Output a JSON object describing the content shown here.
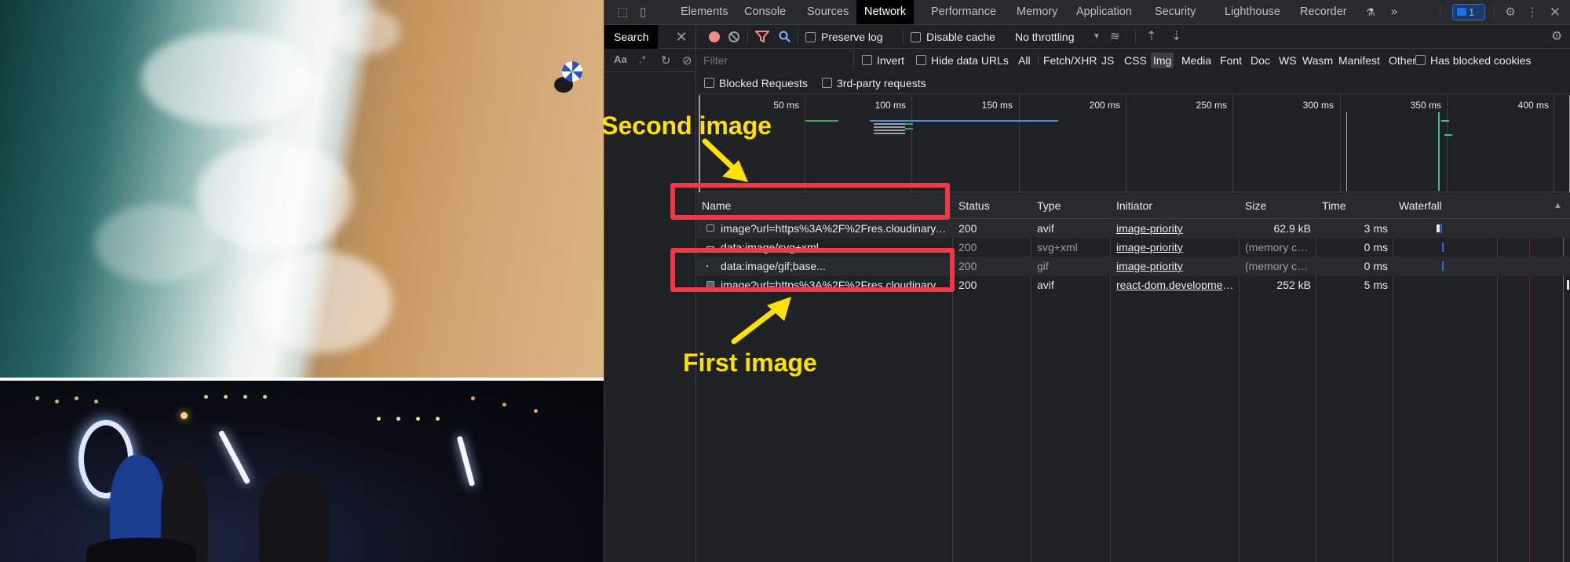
{
  "devtools": {
    "main_tabs": [
      "Elements",
      "Console",
      "Sources",
      "Network",
      "Performance",
      "Memory",
      "Application",
      "Security",
      "Lighthouse",
      "Recorder"
    ],
    "active_tab": "Network",
    "more_tabs": "»",
    "issues_count": "1"
  },
  "search_panel": {
    "title": "Search",
    "match_case": "Aa",
    "regex": ".*"
  },
  "network_toolbar": {
    "preserve_log": "Preserve log",
    "disable_cache": "Disable cache",
    "throttling": "No throttling"
  },
  "filter_bar": {
    "placeholder": "Filter",
    "invert": "Invert",
    "hide_data_urls": "Hide data URLs",
    "type_filters": [
      "All",
      "Fetch/XHR",
      "JS",
      "CSS",
      "Img",
      "Media",
      "Font",
      "Doc",
      "WS",
      "Wasm",
      "Manifest",
      "Other"
    ],
    "active_type": "Img",
    "has_blocked_cookies": "Has blocked cookies",
    "blocked_requests": "Blocked Requests",
    "third_party": "3rd-party requests"
  },
  "overview": {
    "tick_labels": [
      "50 ms",
      "100 ms",
      "150 ms",
      "200 ms",
      "250 ms",
      "300 ms",
      "350 ms",
      "400 ms"
    ]
  },
  "table": {
    "headers": {
      "name": "Name",
      "status": "Status",
      "type": "Type",
      "initiator": "Initiator",
      "size": "Size",
      "time": "Time",
      "waterfall": "Waterfall"
    },
    "rows": [
      {
        "name": "image?url=https%3A%2F%2Fres.cloudinary.com%2F",
        "status": "200",
        "type": "avif",
        "initiator": "image-priority",
        "size": "62.9 kB",
        "time": "3 ms"
      },
      {
        "name": "data:image/svg+xml,...",
        "status": "200",
        "type": "svg+xml",
        "initiator": "image-priority",
        "size": "(memory cache)",
        "time": "0 ms"
      },
      {
        "name": "data:image/gif;base...",
        "status": "200",
        "type": "gif",
        "initiator": "image-priority",
        "size": "(memory cache)",
        "time": "0 ms"
      },
      {
        "name": "image?url=https%3A%2F%2Fres.cloudinary.com%2F",
        "status": "200",
        "type": "avif",
        "initiator": "react-dom.development.js",
        "size": "252 kB",
        "time": "5 ms"
      }
    ]
  },
  "annotations": {
    "second_image": "Second image",
    "first_image": "First image",
    "color": "#ec3a48",
    "text_color": "#ffe100"
  },
  "colors": {
    "record": "#f28b82",
    "link_blue": "#1a73e8",
    "panel_bg": "#202124"
  }
}
